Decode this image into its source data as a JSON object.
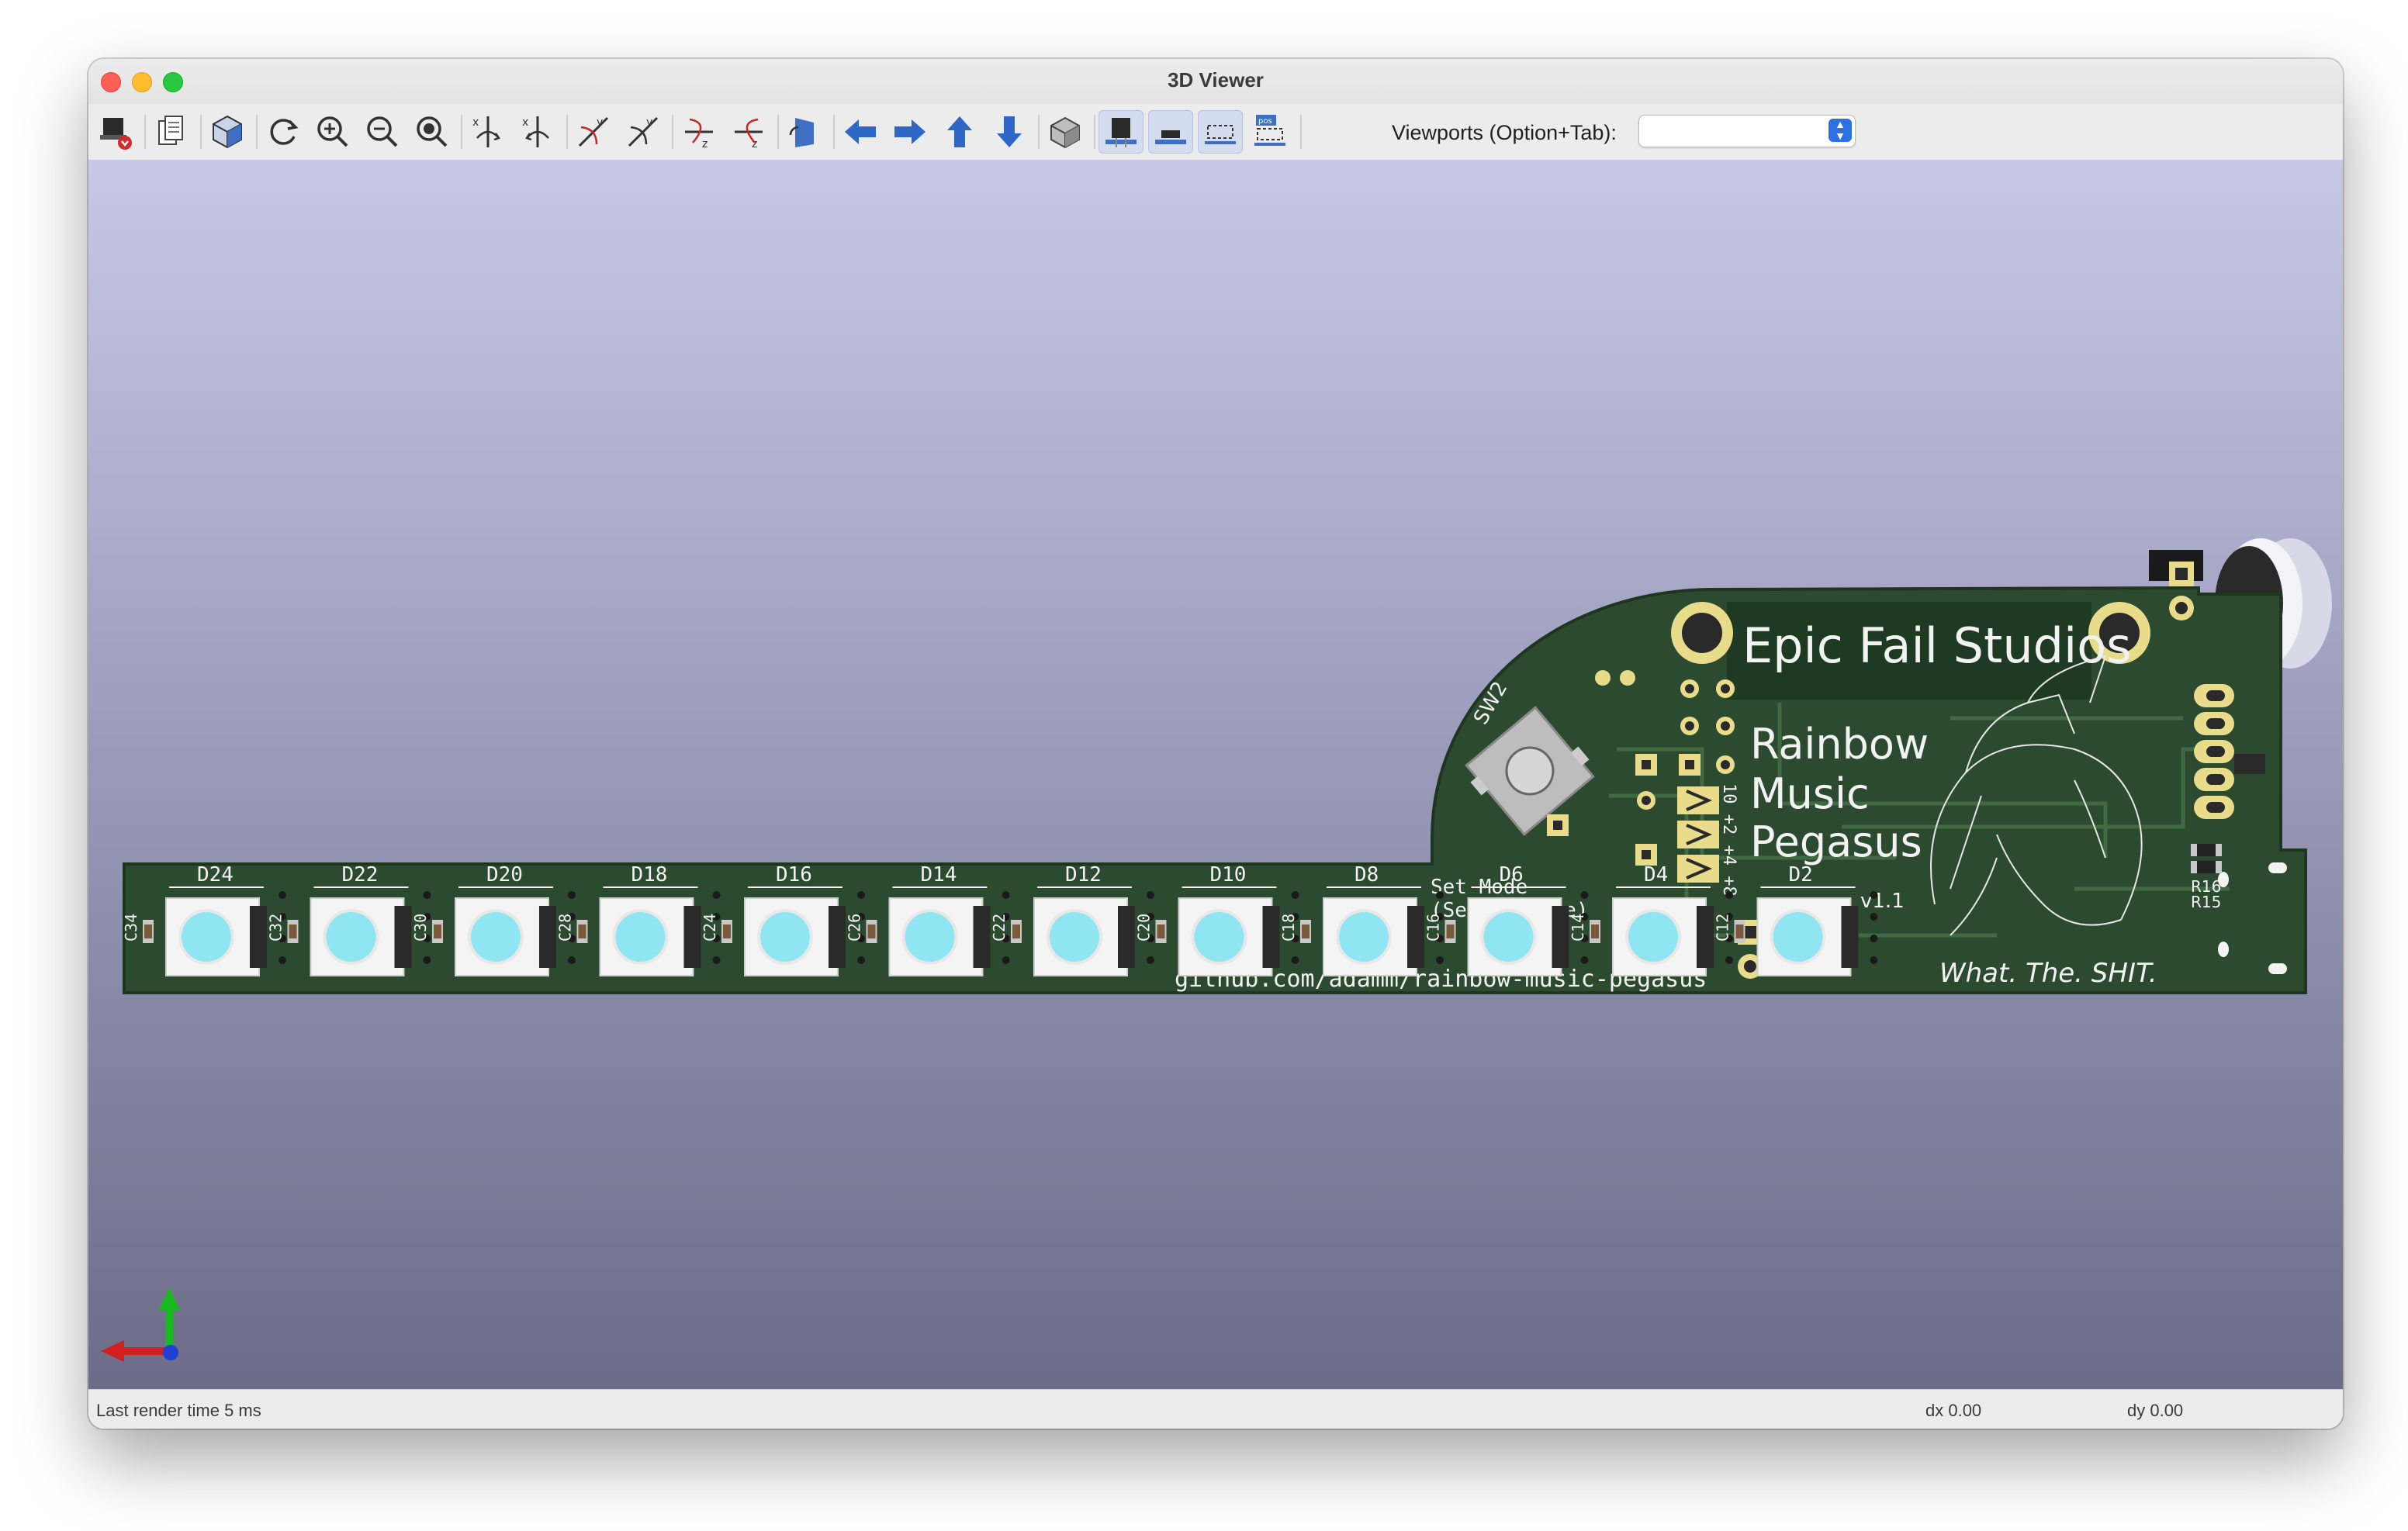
{
  "window": {
    "title": "3D Viewer"
  },
  "toolbar": {
    "buttons": [
      {
        "name": "render-to-image-icon"
      },
      {
        "name": "copy-to-clipboard-icon"
      },
      {
        "name": "raytrace-cube-icon"
      },
      {
        "name": "reload-board-icon"
      },
      {
        "name": "zoom-in-icon"
      },
      {
        "name": "zoom-out-icon"
      },
      {
        "name": "zoom-fit-icon"
      },
      {
        "name": "rotate-x-cw-icon"
      },
      {
        "name": "rotate-x-ccw-icon"
      },
      {
        "name": "rotate-y-cw-icon"
      },
      {
        "name": "rotate-y-ccw-icon"
      },
      {
        "name": "rotate-z-cw-icon"
      },
      {
        "name": "rotate-z-ccw-icon"
      },
      {
        "name": "flip-board-icon"
      },
      {
        "name": "pan-left-icon"
      },
      {
        "name": "pan-right-icon"
      },
      {
        "name": "pan-up-icon"
      },
      {
        "name": "pan-down-icon"
      },
      {
        "name": "ortho-view-icon"
      },
      {
        "name": "show-tht-icon"
      },
      {
        "name": "show-smd-icon"
      },
      {
        "name": "show-virtual-icon"
      },
      {
        "name": "show-not-in-posfile-icon"
      }
    ],
    "viewports_label": "Viewports (Option+Tab):",
    "viewports_value": ""
  },
  "board": {
    "title_line": "Epic Fail Studios",
    "name_lines": [
      "Rainbow",
      "Music",
      "Pegasus"
    ],
    "version": "v1.1",
    "url": "github.com/adamm/rainbow-music-pegasus",
    "signature": "What. The. SHIT.",
    "set_mode": "Set Mode",
    "see_website": "(See website)",
    "switch_ref": "SW2",
    "resistors": [
      "R16",
      "R15"
    ],
    "jumper_labels": "10 +2 +4 +8",
    "led_labels": [
      "D24",
      "D22",
      "D20",
      "D18",
      "D16",
      "D14",
      "D12",
      "D10",
      "D8",
      "D6",
      "D4",
      "D2"
    ],
    "cap_labels": [
      "C34",
      "C32",
      "C30",
      "C28",
      "C24",
      "C26",
      "C22",
      "C20",
      "C18",
      "C16",
      "C14",
      "C12"
    ]
  },
  "status": {
    "render_time": "Last render time 5 ms",
    "dx": "dx 0.00",
    "dy": "dy 0.00"
  },
  "colors": {
    "pcb": "#2c4a2f",
    "led_lens": "#8fe6f2",
    "silkscreen": "#f2f2f2",
    "pad_gold": "#e8dc8a"
  }
}
